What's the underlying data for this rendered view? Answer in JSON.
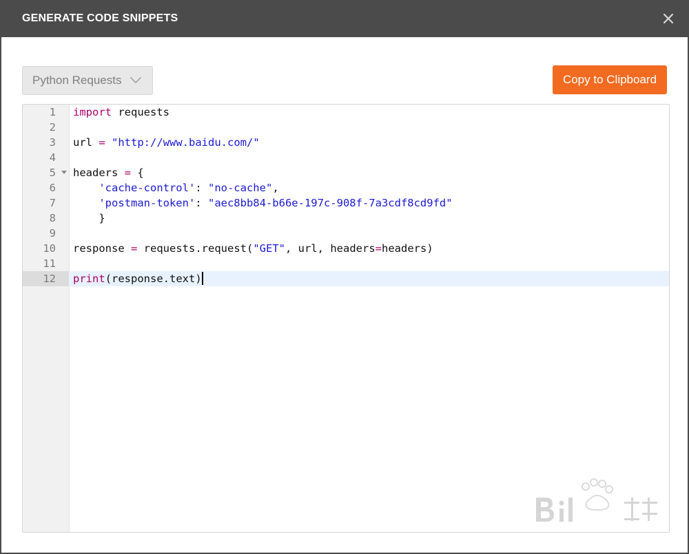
{
  "dialog": {
    "title": "GENERATE CODE SNIPPETS",
    "close_glyph": "✕"
  },
  "toolbar": {
    "language_selected": "Python Requests",
    "copy_label": "Copy to Clipboard"
  },
  "colors": {
    "titlebar": "#4b4b4b",
    "accent": "#f26b21",
    "keyword": "#a8006b",
    "string": "#1a1ad4",
    "active_line": "#e8f2fe"
  },
  "editor": {
    "active_line": 12,
    "lines": [
      {
        "n": "1",
        "tokens": [
          {
            "t": "import",
            "c": "kw"
          },
          {
            "t": " requests",
            "c": ""
          }
        ]
      },
      {
        "n": "2",
        "tokens": []
      },
      {
        "n": "3",
        "tokens": [
          {
            "t": "url ",
            "c": ""
          },
          {
            "t": "=",
            "c": "op"
          },
          {
            "t": " ",
            "c": ""
          },
          {
            "t": "\"http://www.baidu.com/\"",
            "c": "str"
          }
        ]
      },
      {
        "n": "4",
        "tokens": []
      },
      {
        "n": "5",
        "fold": true,
        "tokens": [
          {
            "t": "headers ",
            "c": ""
          },
          {
            "t": "=",
            "c": "op"
          },
          {
            "t": " {",
            "c": ""
          }
        ]
      },
      {
        "n": "6",
        "tokens": [
          {
            "t": "    ",
            "c": ""
          },
          {
            "t": "'cache-control'",
            "c": "str"
          },
          {
            "t": ": ",
            "c": ""
          },
          {
            "t": "\"no-cache\"",
            "c": "str"
          },
          {
            "t": ",",
            "c": ""
          }
        ]
      },
      {
        "n": "7",
        "tokens": [
          {
            "t": "    ",
            "c": ""
          },
          {
            "t": "'postman-token'",
            "c": "str"
          },
          {
            "t": ": ",
            "c": ""
          },
          {
            "t": "\"aec8bb84-b66e-197c-908f-7a3cdf8cd9fd\"",
            "c": "str"
          }
        ]
      },
      {
        "n": "8",
        "tokens": [
          {
            "t": "    }",
            "c": ""
          }
        ]
      },
      {
        "n": "9",
        "tokens": []
      },
      {
        "n": "10",
        "tokens": [
          {
            "t": "response ",
            "c": ""
          },
          {
            "t": "=",
            "c": "op"
          },
          {
            "t": " requests.request(",
            "c": ""
          },
          {
            "t": "\"GET\"",
            "c": "str"
          },
          {
            "t": ", url, headers",
            "c": ""
          },
          {
            "t": "=",
            "c": "op"
          },
          {
            "t": "headers)",
            "c": ""
          }
        ]
      },
      {
        "n": "11",
        "tokens": []
      },
      {
        "n": "12",
        "cursor": true,
        "tokens": [
          {
            "t": "print",
            "c": "kw"
          },
          {
            "t": "(response.text)",
            "c": ""
          }
        ]
      }
    ]
  }
}
